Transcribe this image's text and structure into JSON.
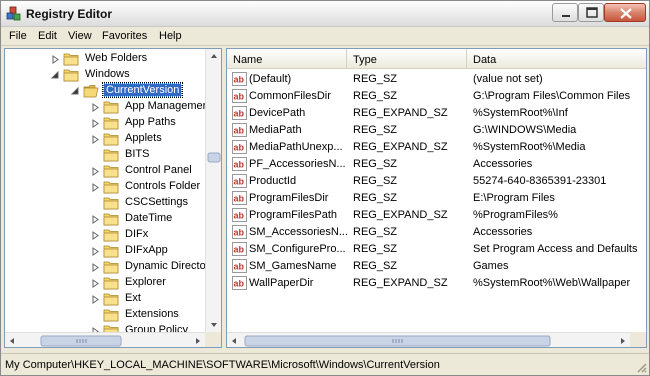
{
  "window": {
    "title": "Registry Editor"
  },
  "menu": [
    "File",
    "Edit",
    "View",
    "Favorites",
    "Help"
  ],
  "tree": {
    "items": [
      {
        "label": "Web Folders",
        "expander": "collapsed"
      },
      {
        "label": "Windows",
        "expander": "expanded"
      },
      {
        "label": "CurrentVersion",
        "expander": "expanded",
        "selected": true,
        "open": true
      },
      {
        "label": "App Managemer",
        "expander": "collapsed"
      },
      {
        "label": "App Paths",
        "expander": "collapsed"
      },
      {
        "label": "Applets",
        "expander": "collapsed"
      },
      {
        "label": "BITS",
        "expander": "none"
      },
      {
        "label": "Control Panel",
        "expander": "collapsed"
      },
      {
        "label": "Controls Folder",
        "expander": "collapsed"
      },
      {
        "label": "CSCSettings",
        "expander": "none"
      },
      {
        "label": "DateTime",
        "expander": "collapsed"
      },
      {
        "label": "DIFx",
        "expander": "collapsed"
      },
      {
        "label": "DIFxApp",
        "expander": "collapsed"
      },
      {
        "label": "Dynamic Directo",
        "expander": "collapsed"
      },
      {
        "label": "Explorer",
        "expander": "collapsed"
      },
      {
        "label": "Ext",
        "expander": "collapsed"
      },
      {
        "label": "Extensions",
        "expander": "none"
      },
      {
        "label": "Group Policy",
        "expander": "collapsed"
      }
    ]
  },
  "list": {
    "columns": [
      "Name",
      "Type",
      "Data"
    ],
    "rows": [
      {
        "name": "(Default)",
        "type": "REG_SZ",
        "data": "(value not set)"
      },
      {
        "name": "CommonFilesDir",
        "type": "REG_SZ",
        "data": "G:\\Program Files\\Common Files"
      },
      {
        "name": "DevicePath",
        "type": "REG_EXPAND_SZ",
        "data": "%SystemRoot%\\Inf"
      },
      {
        "name": "MediaPath",
        "type": "REG_SZ",
        "data": "G:\\WINDOWS\\Media"
      },
      {
        "name": "MediaPathUnexp...",
        "type": "REG_EXPAND_SZ",
        "data": "%SystemRoot%\\Media"
      },
      {
        "name": "PF_AccessoriesN...",
        "type": "REG_SZ",
        "data": "Accessories"
      },
      {
        "name": "ProductId",
        "type": "REG_SZ",
        "data": "55274-640-8365391-23301"
      },
      {
        "name": "ProgramFilesDir",
        "type": "REG_SZ",
        "data": "E:\\Program Files"
      },
      {
        "name": "ProgramFilesPath",
        "type": "REG_EXPAND_SZ",
        "data": "%ProgramFiles%"
      },
      {
        "name": "SM_AccessoriesN...",
        "type": "REG_SZ",
        "data": "Accessories"
      },
      {
        "name": "SM_ConfigurePro...",
        "type": "REG_SZ",
        "data": "Set Program Access and Defaults"
      },
      {
        "name": "SM_GamesName",
        "type": "REG_SZ",
        "data": "Games"
      },
      {
        "name": "WallPaperDir",
        "type": "REG_EXPAND_SZ",
        "data": "%SystemRoot%\\Web\\Wallpaper"
      }
    ]
  },
  "status": {
    "path": "My Computer\\HKEY_LOCAL_MACHINE\\SOFTWARE\\Microsoft\\Windows\\CurrentVersion"
  },
  "icons": {
    "app": "registry-cubes-icon",
    "folder": "folder-icon",
    "value": "string-value-ab-icon"
  },
  "colors": {
    "selection": "#316ac5",
    "folder": "#f5d66b",
    "value_icon_red": "#c0392b"
  }
}
